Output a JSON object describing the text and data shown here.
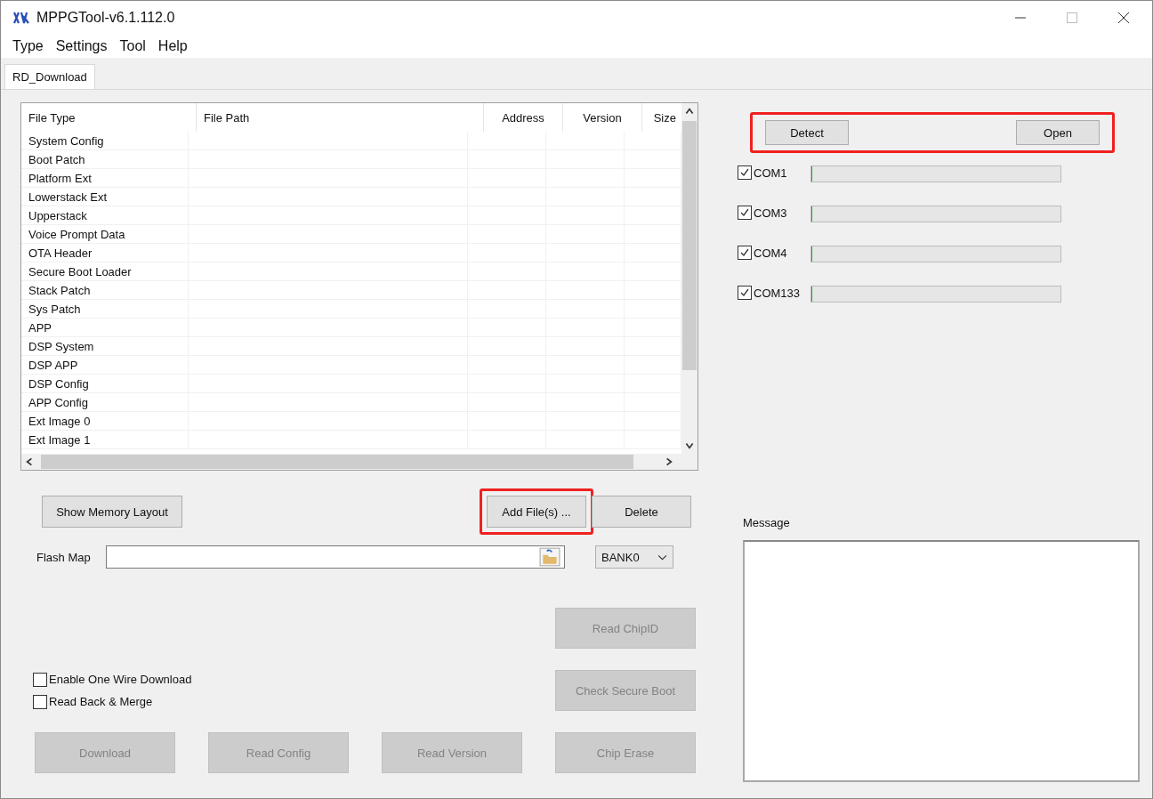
{
  "window": {
    "title": "MPPGTool-v6.1.112.0"
  },
  "menu": [
    "Type",
    "Settings",
    "Tool",
    "Help"
  ],
  "tabs": [
    {
      "label": "RD_Download",
      "selected": true
    }
  ],
  "table": {
    "columns": [
      "File Type",
      "File Path",
      "Address",
      "Version",
      "Size"
    ],
    "rows": [
      {
        "file_type": "System Config"
      },
      {
        "file_type": "Boot Patch"
      },
      {
        "file_type": "Platform Ext"
      },
      {
        "file_type": "Lowerstack Ext"
      },
      {
        "file_type": "Upperstack"
      },
      {
        "file_type": "Voice Prompt Data"
      },
      {
        "file_type": "OTA Header"
      },
      {
        "file_type": "Secure Boot Loader"
      },
      {
        "file_type": "Stack Patch"
      },
      {
        "file_type": "Sys Patch"
      },
      {
        "file_type": "APP"
      },
      {
        "file_type": "DSP System"
      },
      {
        "file_type": "DSP APP"
      },
      {
        "file_type": "DSP Config"
      },
      {
        "file_type": "APP Config"
      },
      {
        "file_type": "Ext Image 0"
      },
      {
        "file_type": "Ext Image 1"
      }
    ]
  },
  "table_buttons": [
    {
      "label": "Show Memory Layout",
      "highlighted": false
    },
    {
      "label": "Add File(s) ...",
      "highlighted": true
    },
    {
      "label": "Delete",
      "highlighted": false
    }
  ],
  "flash_map": {
    "label": "Flash Map",
    "bank": "BANK0"
  },
  "options": [
    {
      "label": "Enable One Wire Download",
      "checked": false
    },
    {
      "label": "Read Back & Merge",
      "checked": false
    }
  ],
  "side_buttons": [
    {
      "label": "Read ChipID",
      "disabled": true
    },
    {
      "label": "Check Secure Boot",
      "disabled": true
    }
  ],
  "action_buttons": [
    {
      "label": "Download",
      "disabled": true
    },
    {
      "label": "Read Config",
      "disabled": true
    },
    {
      "label": "Read Version",
      "disabled": true
    },
    {
      "label": "Chip Erase",
      "disabled": true
    }
  ],
  "port_controls": {
    "highlighted": true,
    "buttons": [
      "Detect",
      "Open"
    ]
  },
  "ports": [
    {
      "name": "COM1",
      "checked": true,
      "level": 0
    },
    {
      "name": "COM3",
      "checked": true,
      "level": 0
    },
    {
      "name": "COM4",
      "checked": true,
      "level": 0
    },
    {
      "name": "COM133",
      "checked": true,
      "level": 0
    }
  ],
  "message": {
    "label": "Message"
  }
}
